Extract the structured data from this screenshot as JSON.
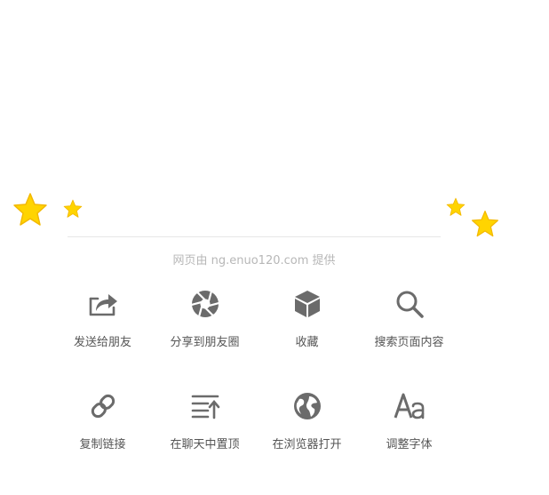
{
  "provider_text": "网页由 ng.enuo120.com 提供",
  "colors": {
    "icon": "#6b6b6b",
    "star_fill": "#ffd400",
    "star_stroke": "#f3b800"
  },
  "actions": [
    {
      "icon": "share-forward-icon",
      "label": "发送给朋友"
    },
    {
      "icon": "aperture-icon",
      "label": "分享到朋友圈"
    },
    {
      "icon": "cube-icon",
      "label": "收藏"
    },
    {
      "icon": "search-icon",
      "label": "搜索页面内容"
    },
    {
      "icon": "link-icon",
      "label": "复制链接"
    },
    {
      "icon": "pin-top-icon",
      "label": "在聊天中置顶"
    },
    {
      "icon": "globe-icon",
      "label": "在浏览器打开"
    },
    {
      "icon": "font-size-icon",
      "label": "调整字体"
    }
  ]
}
